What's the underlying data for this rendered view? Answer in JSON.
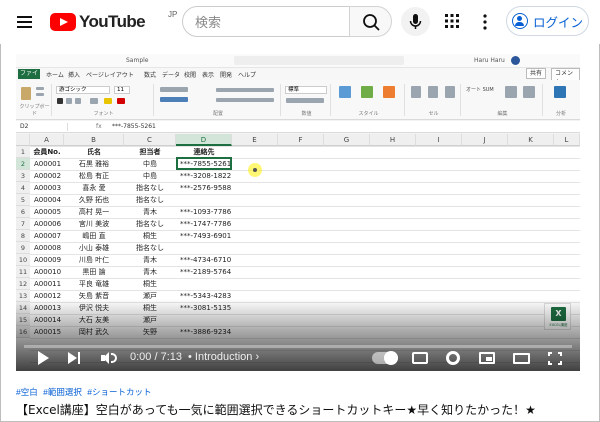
{
  "header": {
    "logo_text": "YouTube",
    "logo_region": "JP",
    "search_placeholder": "検索",
    "login_label": "ログイン"
  },
  "excel": {
    "doc_title": "Sample",
    "user_name": "Haru Haru",
    "tabs": [
      "ファイル",
      "ホーム",
      "挿入",
      "ページレイアウト",
      "数式",
      "データ",
      "校閲",
      "表示",
      "開発",
      "ヘルプ"
    ],
    "share_label": "共有",
    "comment_label": "コメント",
    "ribbon": {
      "font_name": "游ゴシック",
      "font_size": "11",
      "number_format": "標準",
      "autosum_label": "オート SUM",
      "groups": [
        "クリップボード",
        "フォント",
        "配置",
        "数値",
        "スタイル",
        "セル",
        "編集",
        "分析"
      ]
    },
    "name_box": "D2",
    "formula_value": "***-7855-5261",
    "columns": [
      "A",
      "B",
      "C",
      "D",
      "E",
      "F",
      "G",
      "H",
      "I",
      "J",
      "K",
      "L"
    ],
    "selected_column": "D",
    "header_row": [
      "会員No.",
      "氏名",
      "担当者",
      "連絡先"
    ],
    "rows": [
      {
        "num": "1"
      },
      {
        "num": "2",
        "id": "A00001",
        "name": "石黒 雅裕",
        "staff": "中島",
        "phone": "***-7855-5261"
      },
      {
        "num": "3",
        "id": "A00002",
        "name": "松島 有正",
        "staff": "中島",
        "phone": "***-3208-1822"
      },
      {
        "num": "4",
        "id": "A00003",
        "name": "喜永 愛",
        "staff": "指名なし",
        "phone": "***-2576-9588"
      },
      {
        "num": "5",
        "id": "A00004",
        "name": "久野 拓也",
        "staff": "指名なし",
        "phone": ""
      },
      {
        "num": "6",
        "id": "A00005",
        "name": "高村 晃一",
        "staff": "青木",
        "phone": "***-1093-7786"
      },
      {
        "num": "7",
        "id": "A00006",
        "name": "宮川 美波",
        "staff": "指名なし",
        "phone": "***-1747-7786"
      },
      {
        "num": "8",
        "id": "A00007",
        "name": "嶋田 直",
        "staff": "桐生",
        "phone": "***-7493-6901"
      },
      {
        "num": "9",
        "id": "A00008",
        "name": "小山 泰雄",
        "staff": "指名なし",
        "phone": ""
      },
      {
        "num": "10",
        "id": "A00009",
        "name": "川島 叶仁",
        "staff": "青木",
        "phone": "***-4734-6710"
      },
      {
        "num": "11",
        "id": "A00010",
        "name": "黒田 論",
        "staff": "青木",
        "phone": "***-2189-5764"
      },
      {
        "num": "12",
        "id": "A00011",
        "name": "平良 竜雄",
        "staff": "桐生",
        "phone": ""
      },
      {
        "num": "13",
        "id": "A00012",
        "name": "矢島 紫音",
        "staff": "瀬戸",
        "phone": "***-5343-4283"
      },
      {
        "num": "14",
        "id": "A00013",
        "name": "伊沢 悦夫",
        "staff": "桐生",
        "phone": "***-3081-5135"
      },
      {
        "num": "15",
        "id": "A00014",
        "name": "大石 友美",
        "staff": "瀬戸",
        "phone": ""
      },
      {
        "num": "16",
        "id": "A00015",
        "name": "岡村 武久",
        "staff": "矢野",
        "phone": "***-3886-9234"
      }
    ],
    "logo_caption": "EXCEL講座"
  },
  "player": {
    "time": "0:00 / 7:13",
    "chapter": "• Introduction",
    "chapter_arrow": "›",
    "progress": 0.0
  },
  "video": {
    "hashtags": [
      "#空白",
      "#範囲選択",
      "#ショートカット"
    ],
    "title": "【Excel講座】空白があっても一気に範囲選択できるショートカットキー★早く知りたかった！★"
  }
}
